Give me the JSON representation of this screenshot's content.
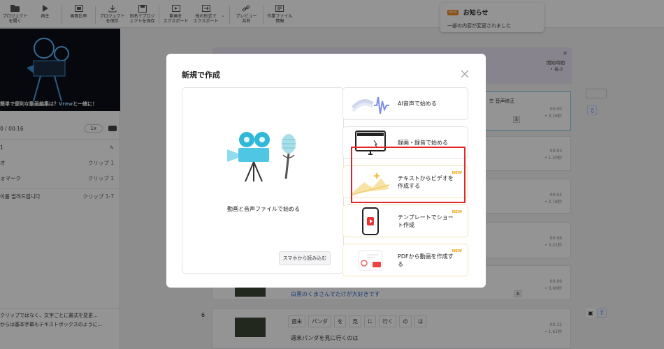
{
  "toolbar": {
    "items": [
      {
        "label": "プロジェクト\nを開く",
        "icon": "folder-icon"
      },
      {
        "label": "再生",
        "icon": "play-icon"
      },
      {
        "label": "画面比率",
        "icon": "aspect-ratio-icon"
      },
      {
        "label": "プロジェクト\nを保存",
        "icon": "save-download-icon"
      },
      {
        "label": "別名でプロジ\nェクトを保存",
        "icon": "save-as-icon"
      },
      {
        "label": "動画を\nエクスポート",
        "icon": "export-video-icon"
      },
      {
        "label": "他の形式で\nエクスポート",
        "icon": "export-other-icon"
      },
      {
        "label": "プレビュー\n共有",
        "icon": "link-icon"
      },
      {
        "label": "作業ファイル\n情報",
        "icon": "file-info-icon"
      }
    ]
  },
  "notice": {
    "badge": "お知らせ",
    "title": "お知らせ",
    "body": "一部の内容が変更されました"
  },
  "left": {
    "caption_pre": "簡単で便利な動画編集は？",
    "caption_accent": "Vrew",
    "caption_post": "と一緒に！",
    "time": "0 / 00:16",
    "speed": "1x",
    "rows": [
      {
        "k": "1",
        "v": ""
      },
      {
        "k": "オ",
        "v": "クリップ 1"
      },
      {
        "k": "ォマーク",
        "v": "クリップ 1"
      },
      {
        "k": "이를 벌려드립니다",
        "v": "クリップ 1-7"
      }
    ],
    "bottom_line1": "クリップではなく、文字ごとに書式を変更...",
    "bottom_line2": "からは基本字幕もテキストボックスのように..."
  },
  "timeline": {
    "banner_title": "開始時間",
    "banner_sub": "• 長さ",
    "voice_fix": "音声修正",
    "rows_meta": [
      {
        "start": "00:00",
        "len": "• 3.26秒"
      },
      {
        "start": "00:03",
        "len": "• 1.20秒"
      },
      {
        "start": "00:04",
        "len": "• 2.18秒"
      },
      {
        "start": "00:06",
        "len": "• 3.21秒"
      },
      {
        "start": "00:09",
        "len": "• 3.00秒"
      },
      {
        "start": "00:12",
        "len": "• 1.61秒"
      }
    ],
    "row5_text": "白黒のくまさんでたけが大好きです",
    "row6_num": "6",
    "row6_tokens": [
      "週末",
      "パンダ",
      "を",
      "見",
      "に",
      "行く",
      "の",
      "は"
    ],
    "row6_text": "週末パンダを見に行くのは",
    "a_glyph": "あ"
  },
  "modal": {
    "title": "新規で作成",
    "big_label": "動画と音声ファイルで始める",
    "phone_button": "スマホから読み込む",
    "options": [
      {
        "label": "AI音声で始める",
        "new": ""
      },
      {
        "label": "録画・録音で始める",
        "new": ""
      },
      {
        "label": "テキストからビデオを作成する",
        "new": "NEW"
      },
      {
        "label": "テンプレートでショート作成",
        "new": "NEW"
      },
      {
        "label": "PDFから動画を作成する",
        "new": "NEW"
      }
    ]
  },
  "colors": {
    "highlight": "#e0262a",
    "accent_orange": "#f2a51b",
    "brand_blue": "#2a6cc7"
  }
}
